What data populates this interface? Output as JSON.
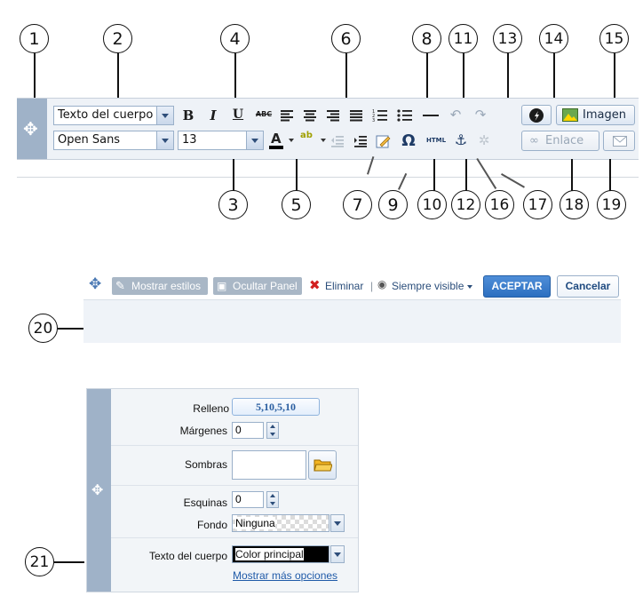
{
  "callouts_top": [
    "1",
    "2",
    "4",
    "6",
    "8",
    "11",
    "13",
    "14",
    "15"
  ],
  "callouts_bottom": [
    "3",
    "5",
    "7",
    "9",
    "10",
    "12",
    "16",
    "17",
    "18",
    "19"
  ],
  "callout_20": "20",
  "callout_21": "21",
  "toolbar": {
    "block_format": "Texto del cuerpo",
    "font_family": "Open Sans",
    "font_size": "13",
    "bold": "B",
    "italic": "I",
    "underline": "U",
    "strike": "ABC",
    "html_icon": "HTML",
    "omega": "Ω",
    "image_label": "Imagen",
    "link_label": "Enlace"
  },
  "bar2": {
    "show_styles": "Mostrar estilos",
    "hide_panel": "Ocultar Panel",
    "delete": "Eliminar",
    "separator": "|",
    "always_visible": "Siempre visible",
    "accept": "ACEPTAR",
    "cancel": "Cancelar"
  },
  "panel": {
    "relleno_label": "Relleno",
    "relleno_value": "5,10,5,10",
    "margenes_label": "Márgenes",
    "margenes_value": "0",
    "sombras_label": "Sombras",
    "esquinas_label": "Esquinas",
    "esquinas_value": "0",
    "fondo_label": "Fondo",
    "fondo_value": "Ninguna",
    "texto_label": "Texto del cuerpo",
    "texto_value": "Color principal",
    "more_options": "Mostrar más opciones"
  },
  "colors": {
    "handle": "#9fb2c8",
    "toolbar_bg": "#eef2f7",
    "accept_blue": "#2c6fc0",
    "link_blue": "#1f5aa8",
    "delete_red": "#d21f1f"
  }
}
